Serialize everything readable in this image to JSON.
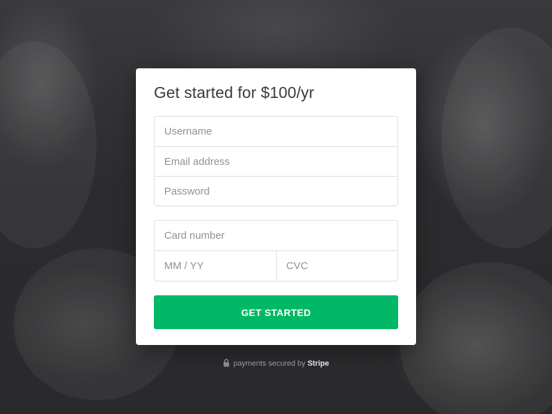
{
  "signup_card": {
    "title": "Get started for $100/yr",
    "account_fields": {
      "username_placeholder": "Username",
      "email_placeholder": "Email address",
      "password_placeholder": "Password"
    },
    "payment_fields": {
      "card_number_placeholder": "Card number",
      "expiry_placeholder": "MM / YY",
      "cvc_placeholder": "CVC"
    },
    "submit_label": "GET STARTED"
  },
  "footer": {
    "prefix": "payments secured by",
    "brand": "Stripe"
  },
  "icons": {
    "lock": "lock-icon"
  },
  "colors": {
    "accent": "#00b865",
    "card_background": "#ffffff",
    "page_background": "#2f2f32",
    "placeholder_text": "#8e9196",
    "title_text": "#3b3b3b"
  }
}
